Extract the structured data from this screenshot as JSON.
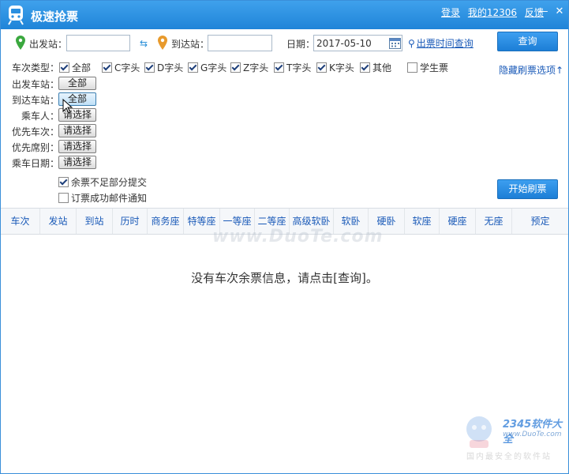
{
  "window": {
    "title": "极速抢票",
    "links": [
      "登录",
      "我的12306",
      "反馈"
    ],
    "minimize": "—",
    "close": "✕"
  },
  "route": {
    "from_label": "出发站：",
    "from_value": "",
    "to_label": "到达站：",
    "to_value": "",
    "date_label": "日期：",
    "date_value": "2017-05-10",
    "time_query_link": "出票时间查询",
    "query_button": "查询"
  },
  "train_types": {
    "label": "车次类型：",
    "items": [
      {
        "label": "全部",
        "checked": true
      },
      {
        "label": "C字头",
        "checked": true
      },
      {
        "label": "D字头",
        "checked": true
      },
      {
        "label": "G字头",
        "checked": true
      },
      {
        "label": "Z字头",
        "checked": true
      },
      {
        "label": "T字头",
        "checked": true
      },
      {
        "label": "K字头",
        "checked": true
      },
      {
        "label": "其他",
        "checked": true
      },
      {
        "label": "学生票",
        "checked": false
      }
    ],
    "hide_options_link": "隐藏刷票选项↑"
  },
  "filters": [
    {
      "label": "出发车站：",
      "button": "全部"
    },
    {
      "label": "到达车站：",
      "button": "全部"
    },
    {
      "label": "乘车人：",
      "button": "请选择"
    },
    {
      "label": "优先车次：",
      "button": "请选择"
    },
    {
      "label": "优先席别：",
      "button": "请选择"
    },
    {
      "label": "乘车日期：",
      "button": "请选择"
    }
  ],
  "options": [
    {
      "label": "余票不足部分提交",
      "checked": true
    },
    {
      "label": "订票成功邮件通知",
      "checked": false
    }
  ],
  "start_button": "开始刷票",
  "table": {
    "columns": [
      "车次",
      "发站",
      "到站",
      "历时",
      "商务座",
      "特等座",
      "一等座",
      "二等座",
      "高级软卧",
      "软卧",
      "硬卧",
      "软座",
      "硬座",
      "无座",
      "预定"
    ],
    "empty_message": "没有车次余票信息，请点击[查询]。"
  },
  "watermarks": {
    "center": "www.DuoTe.com",
    "corner_brand": "2345软件大全",
    "corner_url": "www.DuoTe.com",
    "corner_cn": "国内最安全的软件站"
  }
}
